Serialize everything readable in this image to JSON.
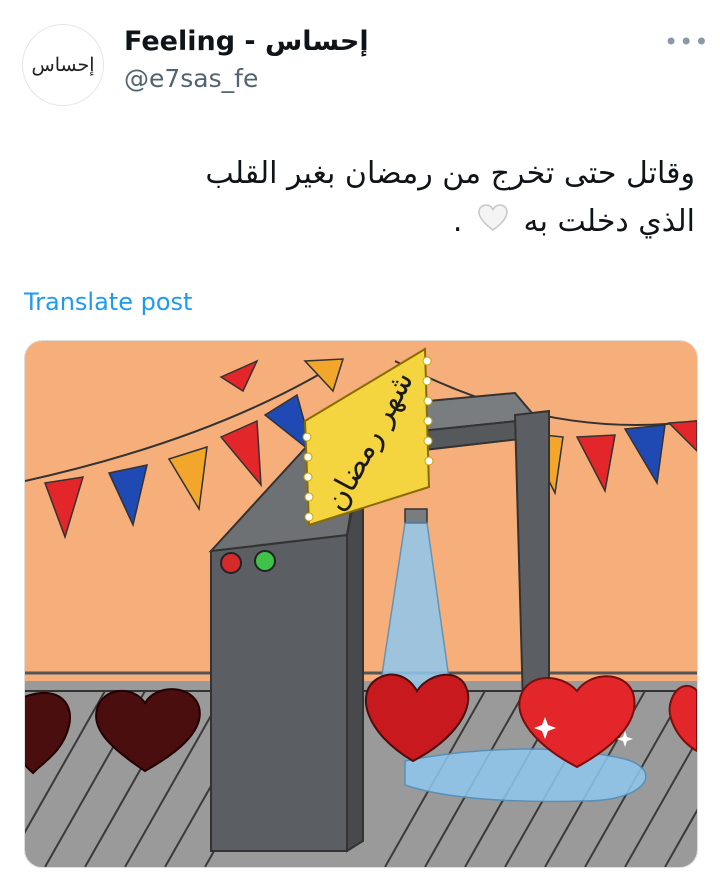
{
  "post": {
    "avatar_text": "إحساس",
    "display_name": "Feeling - إحساس",
    "handle": "@e7sas_fe",
    "more_icon": "more-horizontal-icon",
    "text_line1": "وقاتل حتى تخرج من رمضان بغير القلب",
    "text_line2_before": "الذي دخلت به",
    "text_line2_after": ".",
    "emoji": "white-heart-icon",
    "translate_label": "Translate post"
  },
  "image": {
    "sign_text": "شهر رمضان",
    "colors": {
      "wall": "#f6ae7a",
      "floor": "#9a9a9a",
      "frame": "#5b5e62",
      "sign": "#f4d43f",
      "heart_red": "#e2262a",
      "heart_dark": "#4a0e0e",
      "water": "#8fc8ef"
    }
  }
}
